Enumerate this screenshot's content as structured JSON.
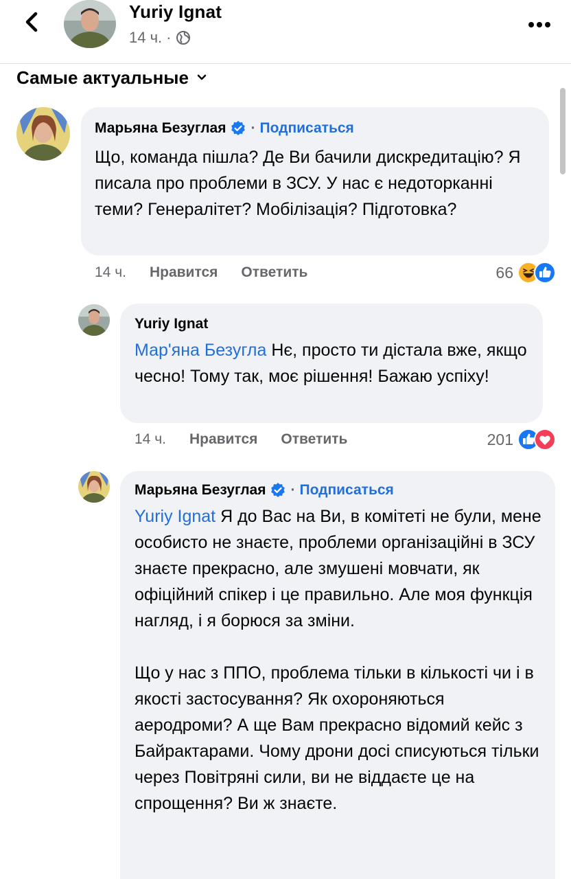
{
  "post_header": {
    "author": "Yuriy Ignat",
    "time": "14 ч.",
    "separator": "·",
    "audience_icon": "globe-icon",
    "more_icon": "more-dots-icon",
    "back_icon": "chevron-left-icon"
  },
  "sort": {
    "label": "Самые актуальные",
    "icon": "chevron-down-icon"
  },
  "actions": {
    "like_label": "Нравится",
    "reply_label": "Ответить"
  },
  "comments": [
    {
      "author": "Марьяна Безуглая",
      "verified": true,
      "dot": "·",
      "subscribe_label": "Подписаться",
      "text": "Що, команда пішла? Де Ви бачили дискредитацію? Я писала про проблеми в ЗСУ. У нас є недоторканні теми? Генералітет? Мобілізація? Підготовка?",
      "time": "14 ч.",
      "reaction_count": "66",
      "reactions": [
        "haha-icon",
        "like-icon"
      ]
    },
    {
      "author": "Yuriy Ignat",
      "verified": false,
      "mention": "Мар'яна Безугла",
      "text": " Нє, просто ти дістала вже, якщо чесно! Тому так, моє рішення! Бажаю успіху!",
      "time": "14 ч.",
      "reaction_count": "201",
      "reactions": [
        "like-icon",
        "love-icon"
      ]
    },
    {
      "author": "Марьяна Безуглая",
      "verified": true,
      "dot": "·",
      "subscribe_label": "Подписаться",
      "mention": "Yuriy Ignat",
      "text": " Я до Вас на Ви, в комітеті не були, мене особисто не знаєте, проблеми організаційні в ЗСУ знаєте прекрасно, але змушені мовчати, як офіційний спікер і це правильно. Але моя функція нагляд, і я борюся за зміни.",
      "text2": "Що у нас з ППО, проблема тільки в кількості чи і в якості застосування? Як охороняються аеродроми? А ще Вам прекрасно відомий кейс з Байрактарами. Чому дрони досі списуються тільки через Повітряні сили, ви не віддаєте це на спрощення? Ви ж знаєте."
    }
  ],
  "colors": {
    "link": "#216fdb",
    "bubble": "#f0f2f5",
    "muted": "#65676b",
    "like": "#1877f2",
    "love": "#f33e58",
    "haha": "#f7b125"
  }
}
